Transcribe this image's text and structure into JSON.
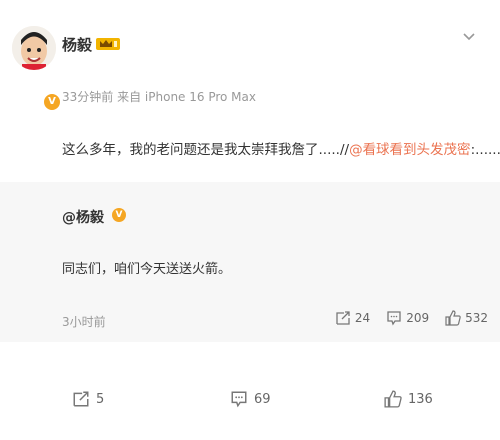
{
  "post": {
    "author": "杨毅",
    "time": "33分钟前",
    "source": "来自 iPhone 16 Pro Max",
    "text_main": "这么多年，我的老问题还是我太崇拜我詹了.....//",
    "mention": "@看球看到头发茂密",
    "text_tail": ":......"
  },
  "quote": {
    "author": "@杨毅",
    "text": "同志们，咱们今天送送火箭。",
    "time": "3小时前",
    "reposts": "24",
    "comments": "209",
    "likes": "532"
  },
  "actions": {
    "reposts": "5",
    "comments": "69",
    "likes": "136"
  },
  "colors": {
    "accent": "#eb7350",
    "badge": "#f5a623",
    "quote_bg": "#f7f7f7",
    "muted": "#999999"
  },
  "icons": [
    "more-chevron-icon",
    "vip-crown-icon",
    "verified-badge-icon",
    "repost-icon",
    "comment-icon",
    "like-icon"
  ]
}
